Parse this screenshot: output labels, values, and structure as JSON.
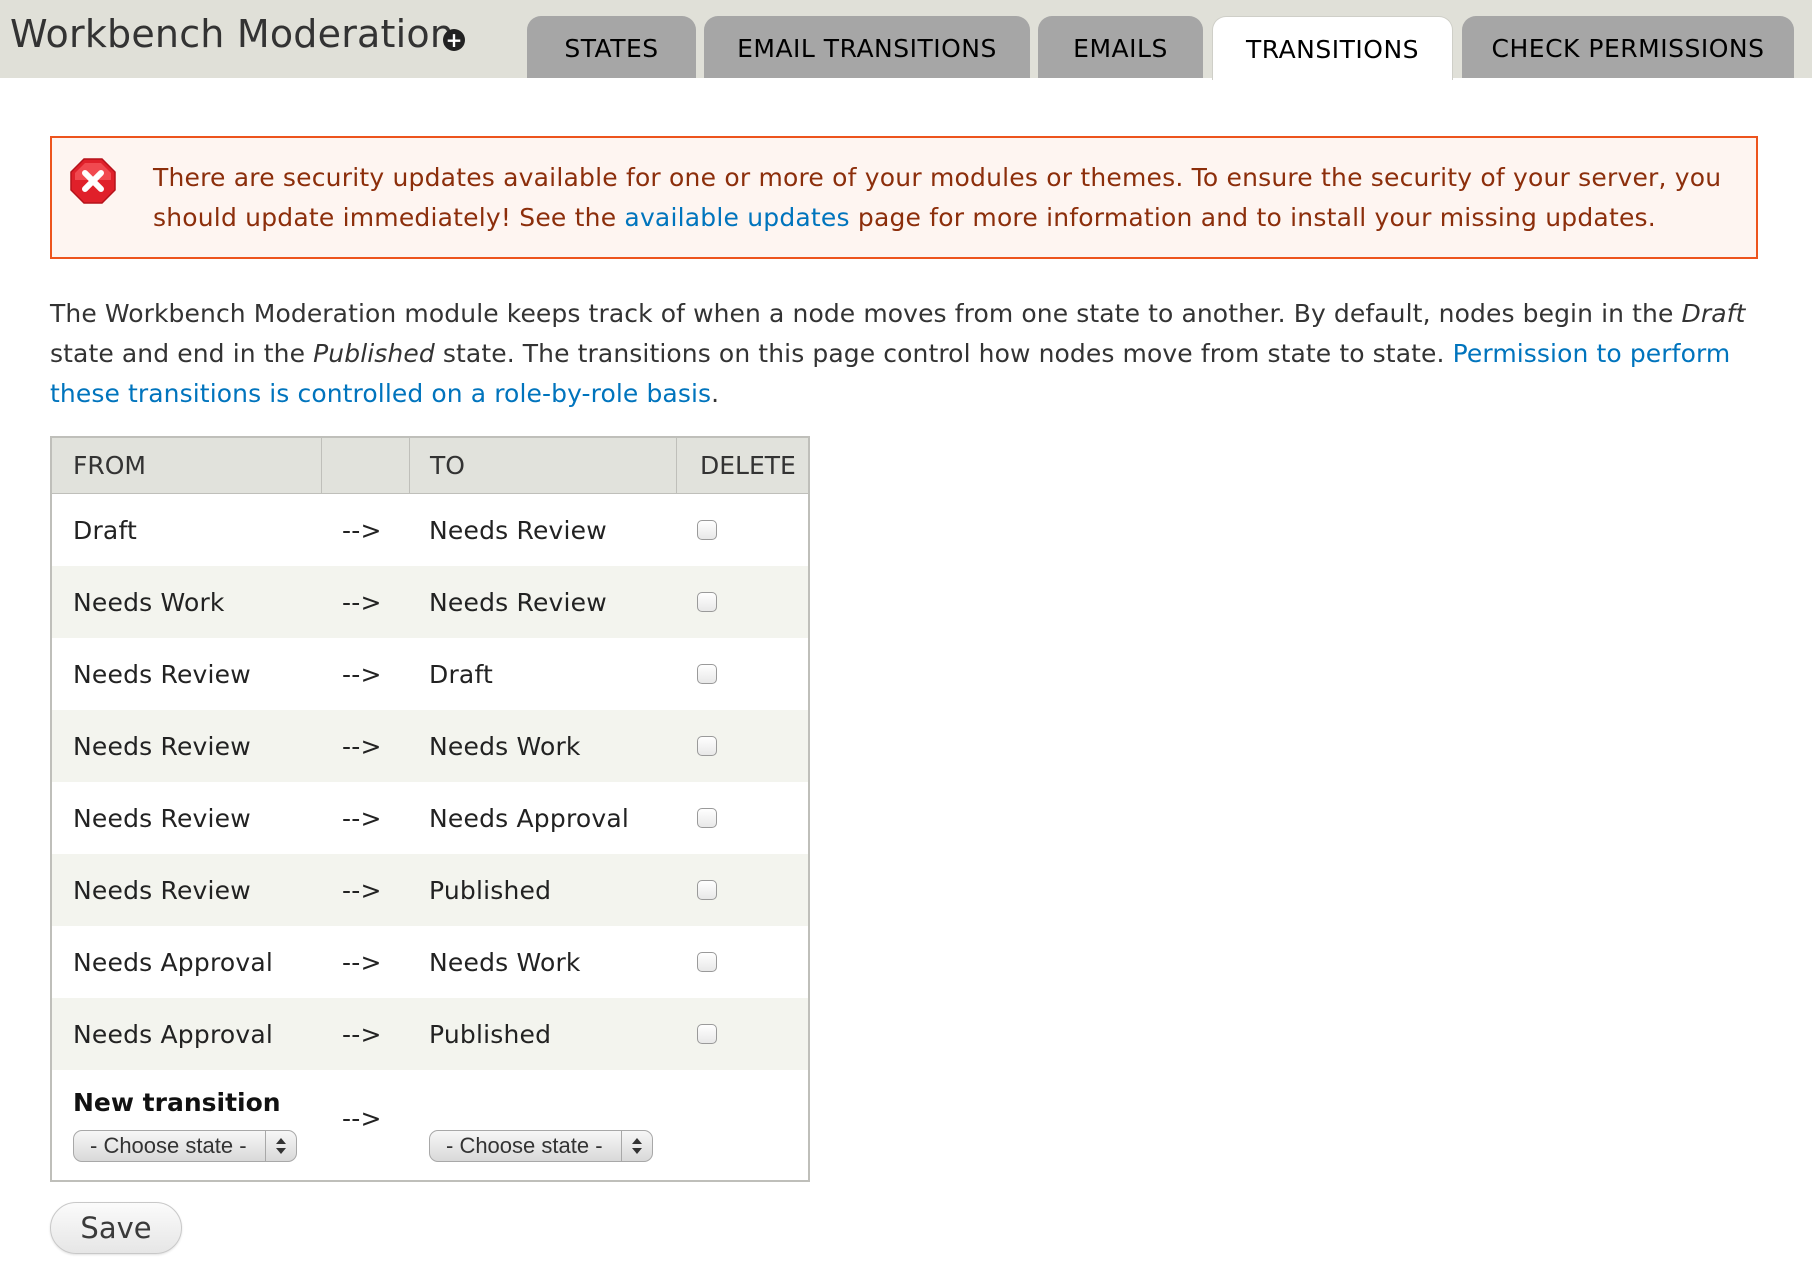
{
  "header": {
    "title": "Workbench Moderation",
    "tabs": [
      {
        "label": "STATES"
      },
      {
        "label": "EMAIL TRANSITIONS"
      },
      {
        "label": "EMAILS"
      },
      {
        "label": "TRANSITIONS",
        "active": true
      },
      {
        "label": "CHECK PERMISSIONS"
      }
    ]
  },
  "alert": {
    "text_before": "There are security updates available for one or more of your modules or themes. To ensure the security of your server, you should update immediately! See the ",
    "link": "available updates",
    "text_after": " page for more information and to install your missing updates."
  },
  "description": {
    "part1": "The Workbench Moderation module keeps track of when a node moves from one state to another. By default, nodes begin in the ",
    "em1": "Draft",
    "part2": " state and end in the ",
    "em2": "Published",
    "part3": " state. The transitions on this page control how nodes move from state to state. ",
    "link": "Permission to perform these transitions is controlled on a role-by-role basis",
    "end": "."
  },
  "table": {
    "headers": {
      "from": "FROM",
      "arrow": "",
      "to": "TO",
      "delete": "DELETE"
    },
    "arrow": "-->",
    "rows": [
      {
        "from": "Draft",
        "arrow": "-->",
        "to": "Needs Review"
      },
      {
        "from": "Needs Work",
        "arrow": "-->",
        "to": "Needs Review"
      },
      {
        "from": "Needs Review",
        "arrow": "-->",
        "to": "Draft"
      },
      {
        "from": "Needs Review",
        "arrow": "-->",
        "to": "Needs Work"
      },
      {
        "from": "Needs Review",
        "arrow": "-->",
        "to": "Needs Approval"
      },
      {
        "from": "Needs Review",
        "arrow": "-->",
        "to": "Published"
      },
      {
        "from": "Needs Approval",
        "arrow": "-->",
        "to": "Needs Work"
      },
      {
        "from": "Needs Approval",
        "arrow": "-->",
        "to": "Published"
      }
    ],
    "new_transition": {
      "label": "New transition",
      "arrow": "-->",
      "from_select": "- Choose state -",
      "to_select": "- Choose state -"
    }
  },
  "save_label": "Save",
  "colors": {
    "alert_border": "#ed541d",
    "alert_text": "#8c2e0b",
    "link": "#0074bd",
    "header_bg": "#e0e0d8",
    "tab_bg": "#a6a6a6"
  }
}
